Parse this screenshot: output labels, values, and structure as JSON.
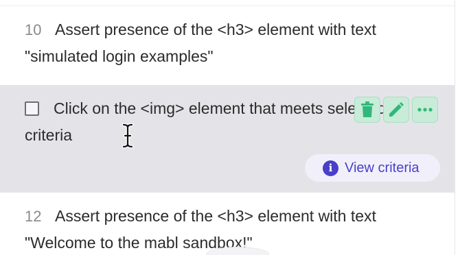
{
  "steps": [
    {
      "number": "10",
      "text": "Assert presence of the <h3> element with text \"simulated login examples\""
    },
    {
      "number": "",
      "text": "Click on the <img> element that meets selected criteria",
      "view_criteria_label": "View criteria"
    },
    {
      "number": "12",
      "text": "Assert presence of the <h3> element with text \"Welcome to the mabl sandbox!\""
    }
  ],
  "icons": {
    "delete": "trash-icon",
    "edit": "pencil-icon",
    "more": "more-options-icon",
    "info": "info-icon",
    "info_glyph": "i"
  },
  "colors": {
    "selected_row": "#e4e4e8",
    "action_button": "#c8ecd8",
    "action_icon": "#2fb87a",
    "accent": "#4a3fc8"
  }
}
